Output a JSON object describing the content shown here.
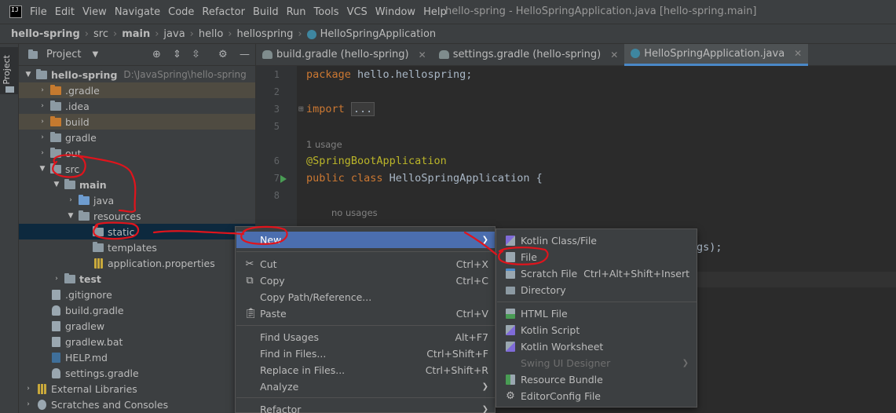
{
  "menubar": {
    "items": [
      "File",
      "Edit",
      "View",
      "Navigate",
      "Code",
      "Refactor",
      "Build",
      "Run",
      "Tools",
      "VCS",
      "Window",
      "Help"
    ],
    "window_title": "hello-spring - HelloSpringApplication.java [hello-spring.main]"
  },
  "breadcrumb": [
    "hello-spring",
    "src",
    "main",
    "java",
    "hello",
    "hellospring",
    "HelloSpringApplication"
  ],
  "tool_stripe": {
    "label": "Project"
  },
  "project_panel": {
    "title": "Project",
    "tree": [
      {
        "label": "hello-spring",
        "hint": "D:\\JavaSpring\\hello-spring"
      },
      {
        "label": ".gradle"
      },
      {
        "label": ".idea"
      },
      {
        "label": "build"
      },
      {
        "label": "gradle"
      },
      {
        "label": "out"
      },
      {
        "label": "src"
      },
      {
        "label": "main"
      },
      {
        "label": "java"
      },
      {
        "label": "resources"
      },
      {
        "label": "static"
      },
      {
        "label": "templates"
      },
      {
        "label": "application.properties"
      },
      {
        "label": "test"
      },
      {
        "label": ".gitignore"
      },
      {
        "label": "build.gradle"
      },
      {
        "label": "gradlew"
      },
      {
        "label": "gradlew.bat"
      },
      {
        "label": "HELP.md"
      },
      {
        "label": "settings.gradle"
      },
      {
        "label": "External Libraries"
      },
      {
        "label": "Scratches and Consoles"
      }
    ]
  },
  "editor_tabs": [
    {
      "label": "build.gradle (hello-spring)"
    },
    {
      "label": "settings.gradle (hello-spring)"
    },
    {
      "label": "HelloSpringApplication.java"
    }
  ],
  "editor": {
    "line_numbers": [
      "1",
      "2",
      "3",
      "5",
      "6",
      "7",
      "8"
    ],
    "package_kw": "package",
    "package_name": " hello.hellospring;",
    "import_kw": "import",
    "import_folded": "...",
    "usage_hint": "1 usage",
    "annotation": "@SpringBootApplication",
    "class_kw": "public class",
    "class_name": " HelloSpringApplication {",
    "no_usages_hint": "no usages",
    "partial_line": "gs);"
  },
  "context_menu": {
    "items": [
      {
        "label": "New",
        "shortcut": "",
        "has_submenu": true
      },
      {
        "label": "Cut",
        "shortcut": "Ctrl+X"
      },
      {
        "label": "Copy",
        "shortcut": "Ctrl+C"
      },
      {
        "label": "Copy Path/Reference...",
        "shortcut": ""
      },
      {
        "label": "Paste",
        "shortcut": "Ctrl+V"
      },
      {
        "label": "Find Usages",
        "shortcut": "Alt+F7"
      },
      {
        "label": "Find in Files...",
        "shortcut": "Ctrl+Shift+F"
      },
      {
        "label": "Replace in Files...",
        "shortcut": "Ctrl+Shift+R"
      },
      {
        "label": "Analyze",
        "shortcut": "",
        "has_submenu": true
      },
      {
        "label": "Refactor",
        "shortcut": "",
        "has_submenu": true
      }
    ]
  },
  "submenu": {
    "items": [
      {
        "label": "Kotlin Class/File",
        "shortcut": ""
      },
      {
        "label": "File",
        "shortcut": ""
      },
      {
        "label": "Scratch File",
        "shortcut": "Ctrl+Alt+Shift+Insert"
      },
      {
        "label": "Directory",
        "shortcut": ""
      },
      {
        "label": "HTML File",
        "shortcut": ""
      },
      {
        "label": "Kotlin Script",
        "shortcut": ""
      },
      {
        "label": "Kotlin Worksheet",
        "shortcut": ""
      },
      {
        "label": "Swing UI Designer",
        "shortcut": "",
        "disabled": true
      },
      {
        "label": "Resource Bundle",
        "shortcut": ""
      },
      {
        "label": "EditorConfig File",
        "shortcut": ""
      }
    ]
  },
  "colors": {
    "background": "#2b2b2b",
    "panel": "#3c3f41",
    "selection": "#0d293e",
    "menu_highlight": "#4b6eaf",
    "annotation_red": "#e0141c"
  }
}
